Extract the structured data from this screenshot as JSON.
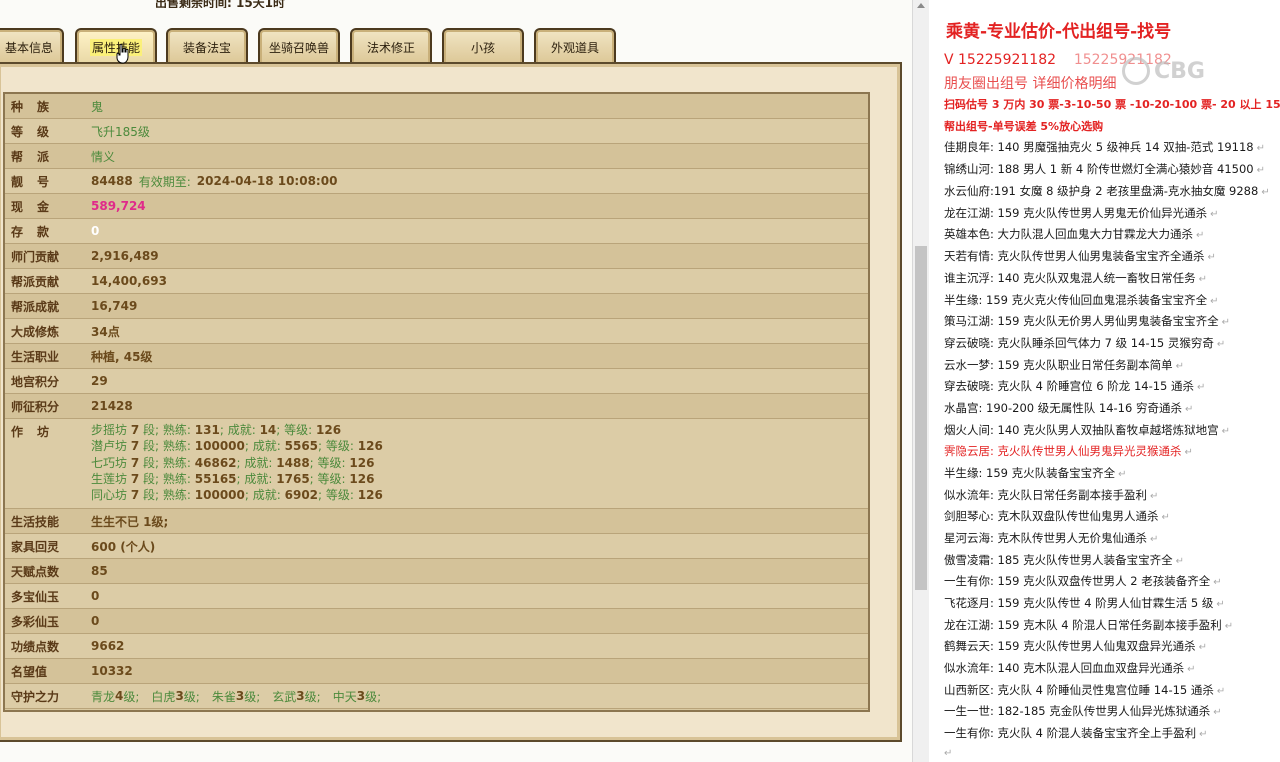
{
  "top_caption": "出售剩余时间:  15天1时",
  "tabs": [
    {
      "label": "基本信息",
      "active": false
    },
    {
      "label": "属性技能",
      "active": true
    },
    {
      "label": "装备法宝",
      "active": false
    },
    {
      "label": "坐骑召唤兽",
      "active": false
    },
    {
      "label": "法术修正",
      "active": false
    },
    {
      "label": "小孩",
      "active": false
    },
    {
      "label": "外观道具",
      "active": false
    }
  ],
  "attrs": {
    "race": {
      "label": "种族",
      "value": "鬼"
    },
    "level": {
      "label": "等级",
      "value": "飞升185级"
    },
    "sect": {
      "label": "帮派",
      "value": "情义"
    },
    "id": {
      "label": "靓号",
      "value": "84488",
      "expire_label": "有效期至:",
      "expire_value": "2024-04-18 10:08:00"
    },
    "cash": {
      "label": "现金",
      "value": "589,724"
    },
    "deposit": {
      "label": "存款",
      "value": "0"
    },
    "master": {
      "label": "师门贡献",
      "value": "2,916,489"
    },
    "guild": {
      "label": "帮派贡献",
      "value": "14,400,693"
    },
    "guild_ach": {
      "label": "帮派成就",
      "value": "16,749"
    },
    "cultivation": {
      "label": "大成修炼",
      "value": "34点"
    },
    "life_job": {
      "label": "生活职业",
      "value": "种植, 45级"
    },
    "palace": {
      "label": "地宫积分",
      "value": "29"
    },
    "expedition": {
      "label": "师征积分",
      "value": "21428"
    },
    "workshop_label": "作坊",
    "workshops": [
      {
        "name": "步摇坊",
        "seg": "7",
        "seg_unit": "段;",
        "skill_label": "熟练:",
        "skill": "131",
        "ach_label": "成就:",
        "ach": "14",
        "lv_label": "等级:",
        "lv": "126"
      },
      {
        "name": "潜卢坊",
        "seg": "7",
        "seg_unit": "段;",
        "skill_label": "熟练:",
        "skill": "100000",
        "ach_label": "成就:",
        "ach": "5565",
        "lv_label": "等级:",
        "lv": "126"
      },
      {
        "name": "七巧坊",
        "seg": "7",
        "seg_unit": "段;",
        "skill_label": "熟练:",
        "skill": "46862",
        "ach_label": "成就:",
        "ach": "1488",
        "lv_label": "等级:",
        "lv": "126"
      },
      {
        "name": "生莲坊",
        "seg": "7",
        "seg_unit": "段;",
        "skill_label": "熟练:",
        "skill": "55165",
        "ach_label": "成就:",
        "ach": "1765",
        "lv_label": "等级:",
        "lv": "126"
      },
      {
        "name": "同心坊",
        "seg": "7",
        "seg_unit": "段;",
        "skill_label": "熟练:",
        "skill": "100000",
        "ach_label": "成就:",
        "ach": "6902",
        "lv_label": "等级:",
        "lv": "126"
      }
    ],
    "life_skill": {
      "label": "生活技能",
      "value": "生生不已 1级;"
    },
    "furniture": {
      "label": "家具回灵",
      "value": "600 (个人)"
    },
    "talent": {
      "label": "天赋点数",
      "value": "85"
    },
    "duobao": {
      "label": "多宝仙玉",
      "value": "0"
    },
    "duocai": {
      "label": "多彩仙玉",
      "value": "0"
    },
    "merit": {
      "label": "功绩点数",
      "value": "9662"
    },
    "fame": {
      "label": "名望值",
      "value": "10332"
    },
    "guardian": {
      "label": "守护之力",
      "items": [
        {
          "name": "青龙",
          "lv": "4",
          "unit": "级;"
        },
        {
          "name": "白虎",
          "lv": "3",
          "unit": "级;"
        },
        {
          "name": "朱雀",
          "lv": "3",
          "unit": "级;"
        },
        {
          "name": "玄武",
          "lv": "3",
          "unit": "级;"
        },
        {
          "name": "中天",
          "lv": "3",
          "unit": "级;"
        }
      ]
    }
  },
  "doc": {
    "heading": "乘黄-专业估价-代出组号-找号",
    "contact": "V 15225921182",
    "contact2": "15225921182",
    "moments": "朋友圈出组号   详细价格明细",
    "watermark": "CBG",
    "pricing": "扫码估号 3 万内 30 票-3-10-50 票  -10-20-100 票- 20 以上 150",
    "guarantee": "帮出组号-单号误差 5%放心选购",
    "lines": [
      {
        "text": "佳期良年: 140 男魔强抽克火 5 级神兵 14 双抽-范式 19118",
        "red": false
      },
      {
        "text": "锦绣山河: 188 男人 1 新 4 阶传世燃灯全满心猿妙音 41500",
        "red": false
      },
      {
        "text": "水云仙府:191 女魔 8 级护身 2 老孩里盘满-克水抽女魔 9288",
        "red": false
      },
      {
        "text": "龙在江湖: 159 克火队传世男人男鬼无价仙异光通杀",
        "red": false
      },
      {
        "text": "英雄本色: 大力队混人回血鬼大力甘霖龙大力通杀",
        "red": false
      },
      {
        "text": "天若有情: 克火队传世男人仙男鬼装备宝宝齐全通杀",
        "red": false
      },
      {
        "text": "谁主沉浮: 140 克火队双鬼混人统一畜牧日常任务",
        "red": false
      },
      {
        "text": "半生缘: 159 克火克火传仙回血鬼混杀装备宝宝齐全",
        "red": false
      },
      {
        "text": "策马江湖: 159 克火队无价男人男仙男鬼装备宝宝齐全",
        "red": false
      },
      {
        "text": "穿云破晓: 克火队睡杀回气体力 7 级 14-15 灵猴穷奇",
        "red": false
      },
      {
        "text": "云水一梦: 159 克火队职业日常任务副本简单",
        "red": false
      },
      {
        "text": "穿去破晓: 克火队 4 阶睡宫位 6 阶龙 14-15 通杀",
        "red": false
      },
      {
        "text": "水晶宫: 190-200 级无属性队 14-16 穷奇通杀",
        "red": false
      },
      {
        "text": "烟火人间: 140 克火队男人双抽队畜牧卓越塔炼狱地宫",
        "red": false
      },
      {
        "text": "霁隐云居: 克火队传世男人仙男鬼异光灵猴通杀",
        "red": true
      },
      {
        "text": "半生缘: 159 克火队装备宝宝齐全",
        "red": false
      },
      {
        "text": "似水流年: 克火队日常任务副本接手盈利",
        "red": false
      },
      {
        "text": "剑胆琴心: 克木队双盘队传世仙鬼男人通杀",
        "red": false
      },
      {
        "text": "星河云海: 克木队传世男人无价鬼仙通杀",
        "red": false
      },
      {
        "text": "傲雪凌霜: 185 克火队传世男人装备宝宝齐全",
        "red": false
      },
      {
        "text": "一生有你: 159 克火队双盘传世男人 2 老孩装备齐全",
        "red": false
      },
      {
        "text": "飞花逐月: 159 克火队传世 4 阶男人仙甘霖生活 5 级",
        "red": false
      },
      {
        "text": "龙在江湖: 159 克木队 4 阶混人日常任务副本接手盈利",
        "red": false
      },
      {
        "text": "鹤舞云天: 159 克火队传世男人仙鬼双盘异光通杀",
        "red": false
      },
      {
        "text": "似水流年: 140 克木队混人回血血双盘异光通杀",
        "red": false
      },
      {
        "text": "山西新区: 克火队 4 阶睡仙灵性鬼宫位睡 14-15 通杀",
        "red": false
      },
      {
        "text": "一生一世: 182-185 克金队传世男人仙异光炼狱通杀",
        "red": false
      },
      {
        "text": "一生有你: 克火队 4 阶混人装备宝宝齐全上手盈利",
        "red": false
      }
    ]
  }
}
